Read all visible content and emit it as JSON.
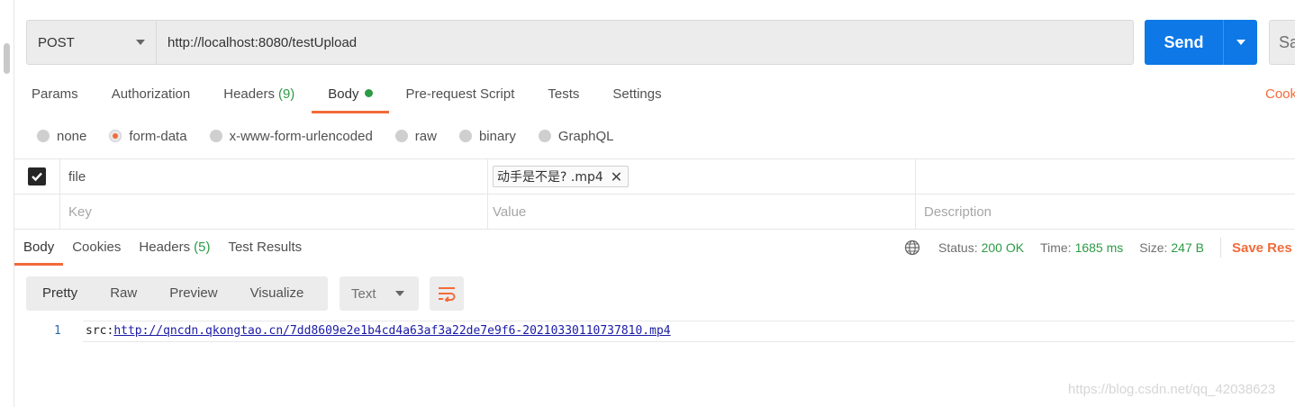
{
  "request": {
    "method": "POST",
    "url": "http://localhost:8080/testUpload",
    "send_label": "Send",
    "save_label": "Sa"
  },
  "request_tabs": [
    {
      "label": "Params"
    },
    {
      "label": "Authorization"
    },
    {
      "label": "Headers",
      "count": "(9)"
    },
    {
      "label": "Body"
    },
    {
      "label": "Pre-request Script"
    },
    {
      "label": "Tests"
    },
    {
      "label": "Settings"
    }
  ],
  "cookies_link": "Cook",
  "body_types": [
    "none",
    "form-data",
    "x-www-form-urlencoded",
    "raw",
    "binary",
    "GraphQL"
  ],
  "body_type_selected": "form-data",
  "params": {
    "rows": [
      {
        "checked": true,
        "key": "file",
        "value": "动手是不是?  .mp4"
      }
    ],
    "placeholders": {
      "key": "Key",
      "value": "Value",
      "description": "Description"
    }
  },
  "response_tabs": [
    {
      "label": "Body"
    },
    {
      "label": "Cookies"
    },
    {
      "label": "Headers",
      "count": "(5)"
    },
    {
      "label": "Test Results"
    }
  ],
  "response_meta": {
    "status_label": "Status:",
    "status_value": "200 OK",
    "time_label": "Time:",
    "time_value": "1685 ms",
    "size_label": "Size:",
    "size_value": "247 B",
    "save_response": "Save Res"
  },
  "view_modes": [
    "Pretty",
    "Raw",
    "Preview",
    "Visualize"
  ],
  "format_selected": "Text",
  "code": {
    "line_number": "1",
    "prefix": "src:",
    "link": "http://qncdn.qkongtao.cn/7dd8609e2e1b4cd4a63af3a22de7e9f6-20210330110737810.mp4"
  },
  "watermark": "https://blog.csdn.net/qq_42038623",
  "colors": {
    "accent_orange": "#f26b3a",
    "send_blue": "#0d78e6",
    "status_green": "#2c9b44"
  }
}
